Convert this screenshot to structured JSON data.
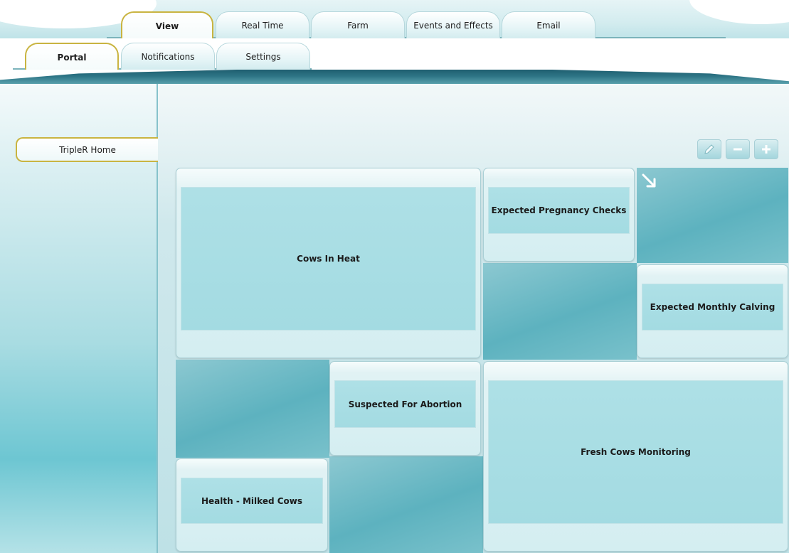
{
  "top_tabs": [
    {
      "label": "View",
      "active": true
    },
    {
      "label": "Real Time",
      "active": false
    },
    {
      "label": "Farm",
      "active": false
    },
    {
      "label": "Events and Effects",
      "active": false
    },
    {
      "label": "Email",
      "active": false
    }
  ],
  "sub_tabs": [
    {
      "label": "Portal",
      "active": true
    },
    {
      "label": "Notifications",
      "active": false
    },
    {
      "label": "Settings",
      "active": false
    }
  ],
  "sidebar": {
    "items": [
      {
        "label": "TripleR Home",
        "active": true
      }
    ]
  },
  "toolbar": {
    "edit_icon": "pencil-icon",
    "zoom_out_icon": "minus-icon",
    "zoom_in_icon": "plus-icon"
  },
  "widgets": {
    "cows_in_heat": "Cows In Heat",
    "expected_pregnancy_checks": "Expected Pregnancy Checks",
    "expected_monthly_calving": "Expected Monthly Calving",
    "suspected_for_abortion": "Suspected For Abortion",
    "fresh_cows_monitoring": "Fresh Cows Monitoring",
    "health_milked_cows": "Health - Milked Cows"
  },
  "colors": {
    "accent_gold": "#c9b441",
    "teal_dark": "#2d7485",
    "widget_fill": "#a3dbe2"
  }
}
